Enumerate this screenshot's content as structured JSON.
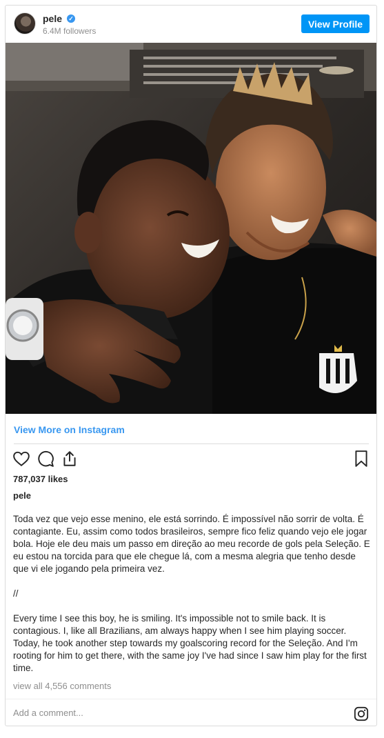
{
  "header": {
    "username": "pele",
    "verified_mark": "✓",
    "followers": "6.4M followers",
    "view_profile_label": "View Profile",
    "avatar_icon": "profile-photo"
  },
  "post": {
    "image_icon": "photo",
    "view_more_label": "View More on Instagram",
    "icons": [
      "heart-icon",
      "comment-icon",
      "share-icon",
      "bookmark-icon"
    ],
    "likes": "787,037 likes",
    "author": "pele",
    "caption": "Toda vez que vejo esse menino, ele está sorrindo. É impossível não sorrir de volta. É contagiante. Eu, assim como todos brasileiros, sempre fico feliz quando vejo ele jogar bola. Hoje ele deu mais um passo em direção ao meu recorde de gols pela Seleção. E eu estou na torcida para que ele chegue lá, com a mesma alegria que tenho desde que vi ele jogando pela primeira vez.\n\n//\n\nEvery time I see this boy, he is smiling. It's impossible not to smile back. It is contagious. I, like all Brazilians, am always happy when I see him playing soccer. Today, he took another step towards my goalscoring record for the Seleção. And I'm rooting for him to get there, with the same joy I've had since I saw him play for the first time.",
    "view_comments": "view all 4,556 comments"
  },
  "comment_box": {
    "placeholder": "Add a comment...",
    "value": ""
  },
  "colors": {
    "accent": "#0095f6",
    "link": "#3897f0",
    "muted": "#8e8e8e",
    "text": "#262626",
    "border": "#dbdbdb"
  }
}
